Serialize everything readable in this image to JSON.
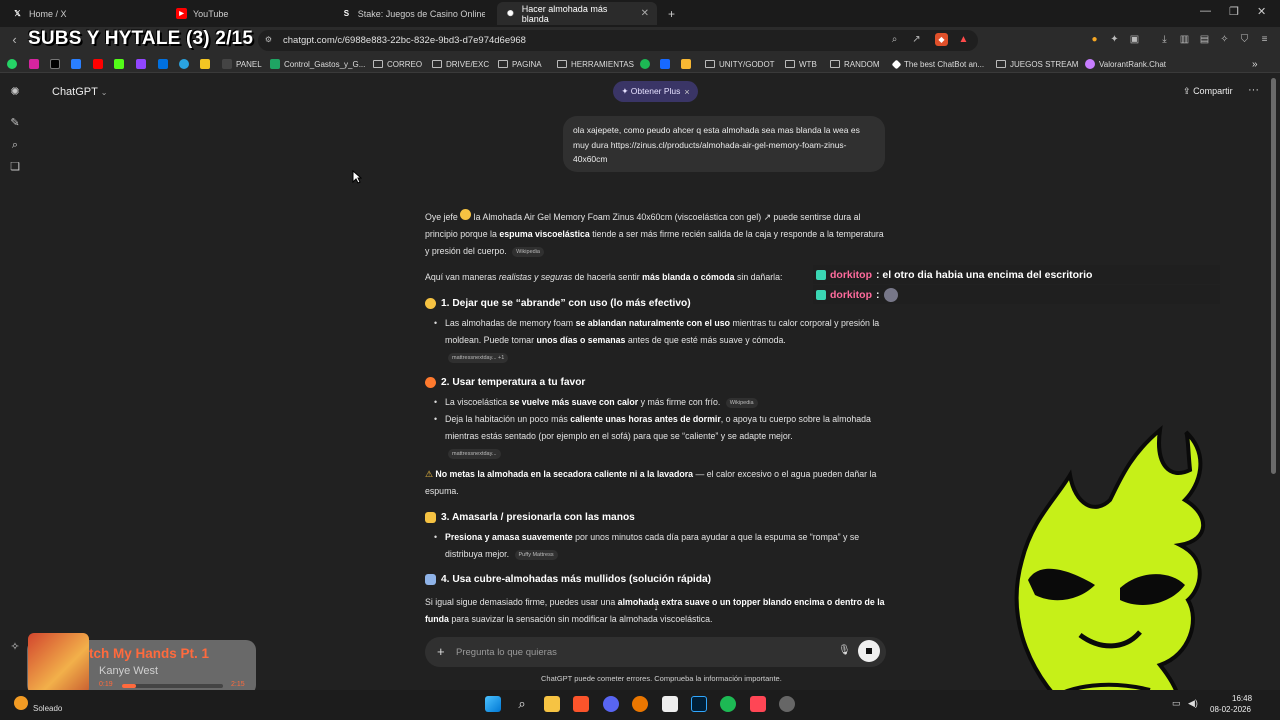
{
  "browser": {
    "tabs": [
      {
        "label": "Home / X",
        "icon": "x-icon",
        "active": false
      },
      {
        "label": "YouTube",
        "icon": "youtube-icon",
        "active": false
      },
      {
        "label": "Stake: Juegos de Casino Online y Ap",
        "icon": "stake-icon",
        "active": false
      },
      {
        "label": "Hacer almohada más blanda",
        "icon": "chatgpt-icon",
        "active": true
      }
    ],
    "new_tab": "+",
    "url": "chatgpt.com/c/6988e883-22bc-832e-9bd3-d7e974d6e968",
    "bookmarks": [
      "PANEL",
      "Control_Gastos_y_G...",
      "CORREO",
      "DRIVE/EXC",
      "PAGINA",
      "HERRAMIENTAS",
      "UNITY/GODOT",
      "WTB",
      "RANDOM",
      "The best ChatBot an...",
      "JUEGOS STREAM",
      "ValorantRank.Chat"
    ]
  },
  "stream_overlay": {
    "title": "SUBS Y HYTALE (3) 2/15"
  },
  "app": {
    "model_label": "ChatGPT",
    "plus_button": "✦ Obtener Plus",
    "plus_close": "×",
    "share_label": "Compartir",
    "more": "···"
  },
  "conversation": {
    "user_message": "ola xajepete, como peudo ahcer q esta almohada sea mas blanda la wea es muy dura https://zinus.cl/products/almohada-air-gel-memory-foam-zinus-40x60cm",
    "intro_p1a": "Oye jefe ",
    "intro_p1b": " la Almohada Air Gel Memory Foam Zinus 40x60cm (viscoelástica con gel) ↗ puede sentirse dura al principio porque la ",
    "intro_p1_bold": "espuma viscoelástica",
    "intro_p1c": " tiende a ser más firme recién salida de la caja y responde a la temperatura y presión del cuerpo.",
    "src_wiki": "Wikipedia",
    "intro_p2a": "Aquí van maneras ",
    "intro_p2_italic": "realistas y seguras",
    "intro_p2b": " de hacerla sentir ",
    "intro_p2_bold": "más blanda o cómoda",
    "intro_p2c": " sin dañarla:",
    "h1": "1. Dejar que se “abrande” con uso (lo más efectivo)",
    "h1_li_a": "Las almohadas de memory foam ",
    "h1_li_bold1": "se ablandan naturalmente con el uso",
    "h1_li_b": " mientras tu calor corporal y presión la moldean. Puede tomar ",
    "h1_li_bold2": "unos días o semanas",
    "h1_li_c": " antes de que esté más suave y cómoda.",
    "src_mattress1": "mattressnextday... +1",
    "h2": "2. Usar temperatura a tu favor",
    "h2_li1_a": "La viscoelástica ",
    "h2_li1_bold": "se vuelve más suave con calor",
    "h2_li1_b": " y más firme con frío.",
    "h2_li2_a": "Deja la habitación un poco más ",
    "h2_li2_bold": "caliente unas horas antes de dormir",
    "h2_li2_b": ", o apoya tu cuerpo sobre la almohada mientras estás sentado (por ejemplo en el sofá) para que se “caliente” y se adapte mejor.",
    "src_mattress2": "mattressnextday...",
    "warning_bold": "No metas la almohada en la secadora caliente ni a la lavadora",
    "warning_rest": " — el calor excesivo o el agua pueden dañar la espuma.",
    "h3": "3. Amasarla / presionarla con las manos",
    "h3_li_bold": "Presiona y amasa suavemente",
    "h3_li_rest": " por unos minutos cada día para ayudar a que la espuma se “rompa” y se distribuya mejor.",
    "src_puffy": "Puffy Mattress",
    "h4": "4. Usa cubre-almohadas más mullidos (solución rápida)",
    "h4_p_a": "Si igual sigue demasiado firme, puedes usar una ",
    "h4_p_bold1": "almohada extra suave o un topper blando encima o dentro de la funda",
    "h4_p_b": " para suavizar la sensación sin modificar la almohada viscoelástica."
  },
  "twitch_chat": [
    {
      "user": "dorkitop",
      "message": ": el otro dia habia una encima del escritorio"
    },
    {
      "user": "dorkitop",
      "message": ":"
    }
  ],
  "composer": {
    "placeholder": "Pregunta lo que quieras",
    "disclaimer": "ChatGPT puede cometer errores. Comprueba la información importante."
  },
  "spotify": {
    "song": "tch My Hands Pt. 1",
    "artist": "Kanye West",
    "elapsed": "0:19",
    "total": "2:15",
    "progress": 0.14
  },
  "taskbar": {
    "weather": "Soleado",
    "time": "16:48",
    "date": "08-02-2026"
  },
  "colors": {
    "accent_plus": "#3a3566",
    "chat_name": "#ff6b9d",
    "spotify": "#ff6a3d",
    "mascot": "#c6f018"
  }
}
